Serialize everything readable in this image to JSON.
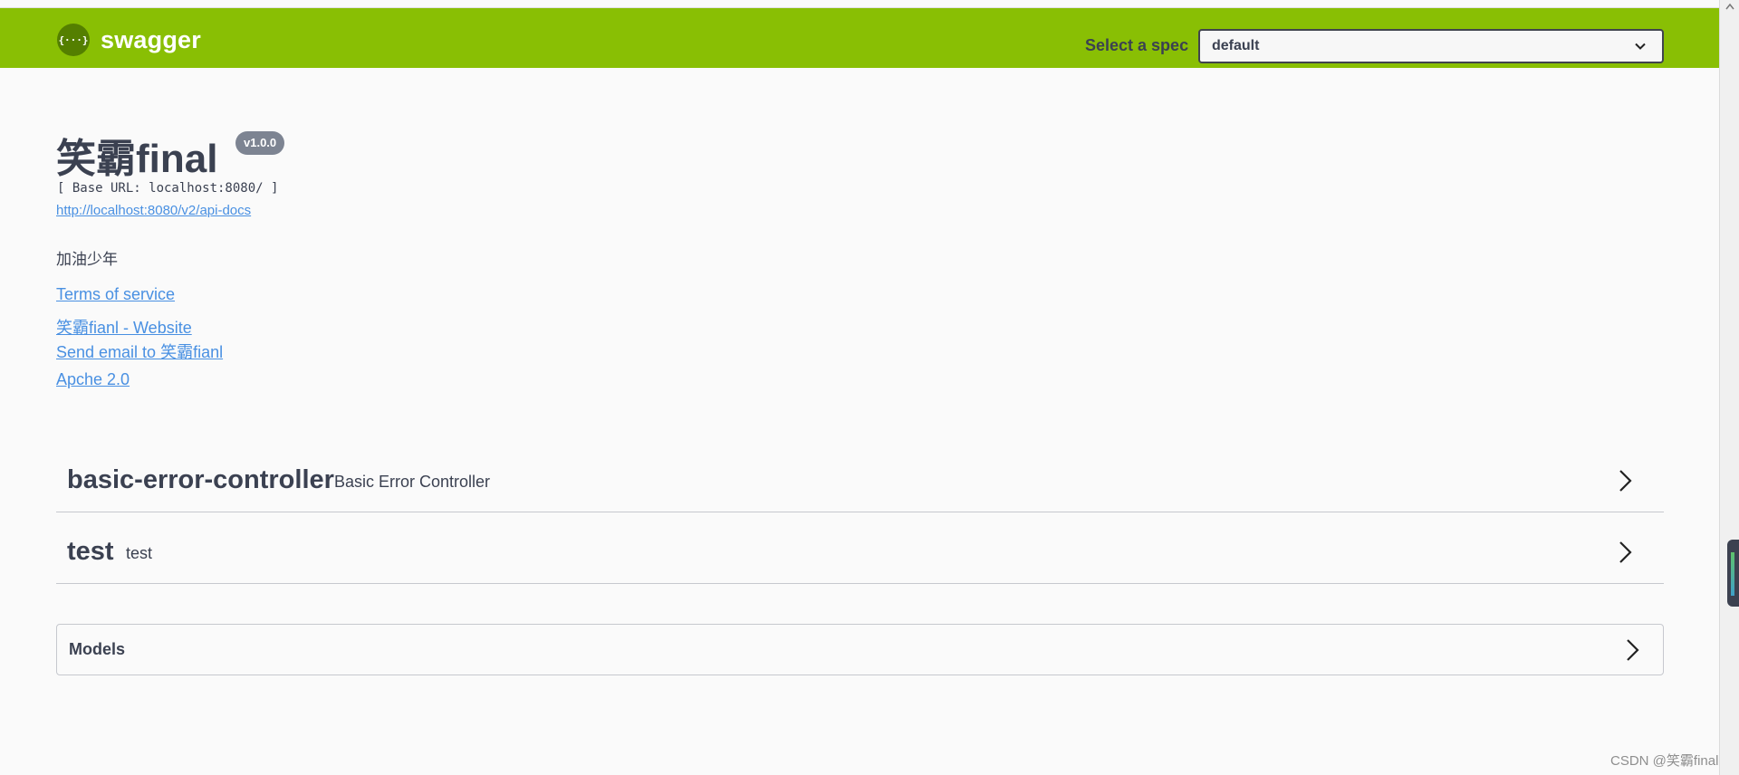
{
  "topbar": {
    "logo_glyph": "{···}",
    "logo_text": "swagger",
    "spec_label": "Select a spec",
    "spec_value": "default"
  },
  "info": {
    "title": "笑霸final",
    "version": "v1.0.0",
    "base_url": "[ Base URL: localhost:8080/ ]",
    "api_docs_link": "http://localhost:8080/v2/api-docs",
    "description": "加油少年",
    "terms_link": "Terms of service",
    "website_link": "笑霸fianl - Website",
    "email_link": "Send email to 笑霸fianl",
    "license_link": "Apche 2.0"
  },
  "tags": [
    {
      "name": "basic-error-controller",
      "description": "Basic Error Controller"
    },
    {
      "name": "test",
      "description": "test"
    }
  ],
  "models": {
    "title": "Models"
  },
  "watermark": "CSDN @笑霸final",
  "colors": {
    "topbar": "#89bf04",
    "link": "#4990e2",
    "text": "#3b4151",
    "badge": "#7d8492"
  }
}
